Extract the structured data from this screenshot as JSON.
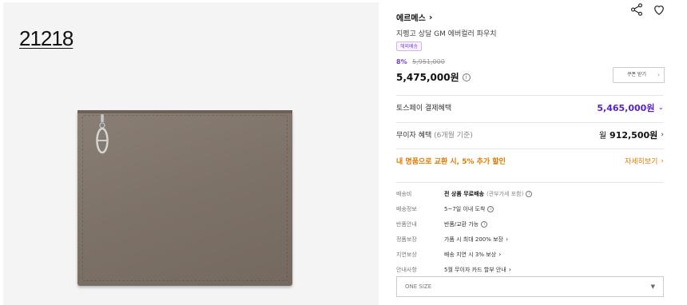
{
  "image": {
    "sku": "21218"
  },
  "product": {
    "brand": "에르메스",
    "name": "지펭고 상달 GM 에버컬러 파우치",
    "badge": "해외배송",
    "discount": "8%",
    "original_price": "5,951,000",
    "price": "5,475,000원",
    "coupon_label": "쿠폰 받기"
  },
  "benefits": {
    "toss_label": "토스페이 결제혜택",
    "toss_value": "5,465,000원",
    "installment_label": "무이자 혜택",
    "installment_sub": "(6개월 기준)",
    "installment_prefix": "월",
    "installment_value": "912,500원",
    "trade_in_label": "내 명품으로 교환 시, 5% 추가 할인",
    "trade_in_link": "자세히보기"
  },
  "info": [
    {
      "key": "배송비",
      "value_bold": "전 상품 무료배송",
      "value_muted": "(관부가세 포함)",
      "icon": "info-circle-icon"
    },
    {
      "key": "배송정보",
      "value": "5~7일 이내 도착",
      "icon": "info-circle-icon"
    },
    {
      "key": "반품안내",
      "value": "반품/교환 가능",
      "icon": "info-circle-icon"
    },
    {
      "key": "정품보장",
      "value": "가품 시 최대 200% 보장",
      "icon": "chevron-right-icon"
    },
    {
      "key": "지연보상",
      "value": "배송 지연 시 3% 보상",
      "icon": "chevron-right-icon"
    },
    {
      "key": "안내사항",
      "value": "5월 무이자 카드 할부 안내",
      "icon": "chevron-right-icon"
    }
  ],
  "size_select": {
    "selected": "ONE SIZE"
  },
  "colors": {
    "accent_purple": "#7b3fd6",
    "toss_purple": "#5a22c0",
    "orange": "#e07a00",
    "pouch_brown": "#7d7268"
  }
}
